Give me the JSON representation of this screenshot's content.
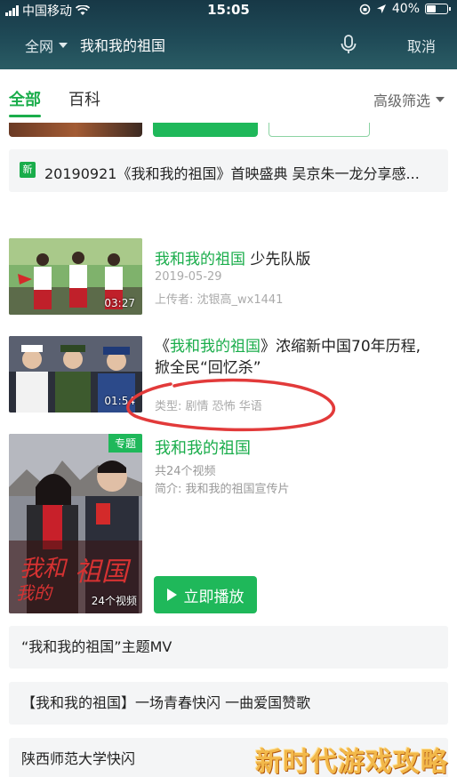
{
  "status_bar": {
    "carrier": "中国移动",
    "time": "15:05",
    "battery": "40%"
  },
  "search": {
    "scope": "全网",
    "query": "我和我的祖国",
    "cancel": "取消"
  },
  "tabs": [
    {
      "label": "全部"
    },
    {
      "label": "百科"
    }
  ],
  "filter": {
    "label": "高级筛选"
  },
  "news": {
    "badge": "新",
    "text": "20190921《我和我的祖国》首映盛典 吴京朱一龙分享感..."
  },
  "videos": [
    {
      "title_highlight": "我和我的祖国",
      "title_rest": " 少先队版",
      "date": "2019-05-29",
      "uploader": "上传者: 沈银高_wx1441",
      "duration": "03:27"
    },
    {
      "title_prefix": "《",
      "title_highlight": "我和我的祖国",
      "title_rest": "》浓缩新中国70年历程,",
      "title_line2": "掀全民“回忆杀”",
      "genre": "类型: 剧情 恐怖 华语",
      "duration": "01:54"
    }
  ],
  "topic": {
    "badge": "专题",
    "title": "我和我的祖国",
    "count": "共24个视频",
    "desc": "简介: 我和我的祖国宣传片",
    "thumb_count": "24个视频",
    "play_label": "立即播放"
  },
  "related": [
    {
      "text": "“我和我的祖国”主题MV"
    },
    {
      "text": "【我和我的祖国】一场青春快闪 一曲爱国赞歌"
    },
    {
      "text": "陕西师范大学快闪"
    }
  ],
  "watermark": "新时代游戏攻略",
  "colors": {
    "accent": "#1aad4b",
    "header": "#1f4a57",
    "annotation": "#e23a3a"
  }
}
